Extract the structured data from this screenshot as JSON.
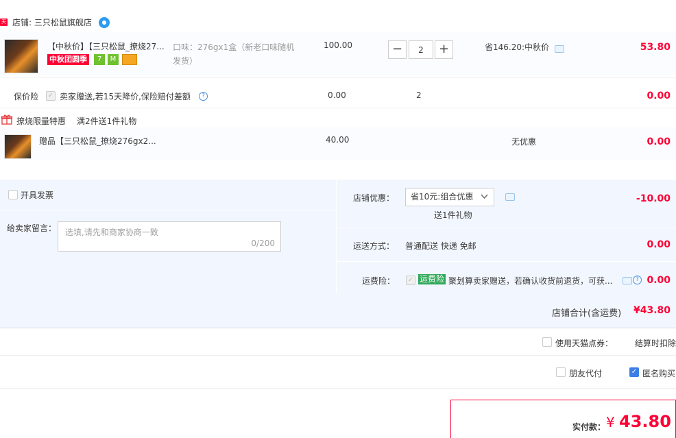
{
  "shop": {
    "badge": "天猫",
    "name": "店铺: 三只松鼠旗舰店"
  },
  "product": {
    "title": "【中秋价】【三只松鼠_撩烧27...",
    "tag_promo": "中秋团圆季",
    "tag_green_1": "7",
    "tag_green_2": "M",
    "sku_line1": "口味：276gx1盒（新老口味随机",
    "sku_line2": "发货）",
    "unit_price": "100.00",
    "quantity": "2",
    "qty_minus": "−",
    "qty_plus": "+",
    "discount": "省146.20:中秋价",
    "total": "53.80"
  },
  "insurance": {
    "label": "保价险",
    "desc": "卖家赠送,若15天降价,保险赔付差额",
    "help": "?",
    "unit_price": "0.00",
    "quantity": "2",
    "total": "0.00"
  },
  "gift_promo": {
    "title": "撩烧限量特惠",
    "rule": "满2件送1件礼物"
  },
  "gift": {
    "title": "赠品【三只松鼠_撩烧276gx2...",
    "unit_price": "40.00",
    "discount": "无优惠",
    "total": "0.00"
  },
  "invoice": {
    "label": "开具发票"
  },
  "memo": {
    "label": "给卖家留言：",
    "placeholder": "选填,请先和商家协商一致",
    "counter": "0/200"
  },
  "shop_discount": {
    "label": "店铺优惠：",
    "selected": "省10元:组合优惠",
    "sub": "送1件礼物",
    "amount": "-10.00"
  },
  "shipping": {
    "label": "运送方式：",
    "value": "普通配送 快递 免邮",
    "amount": "0.00"
  },
  "freight_insurance": {
    "label": "运费险：",
    "badge": "运费险",
    "desc": "聚划算卖家赠送，若确认收货前退货，可获...",
    "help": "?",
    "amount": "0.00"
  },
  "shop_total": {
    "label": "店铺合计(含运费)",
    "amount": "¥43.80"
  },
  "coupon": {
    "label": "使用天猫点券：",
    "note": "结算时扣除"
  },
  "friend_pay": {
    "label": "朋友代付"
  },
  "anonymous": {
    "label": "匿名购买"
  },
  "final": {
    "label": "实付款：",
    "currency": "¥",
    "amount": "43.80"
  },
  "colors": {
    "accent_red": "#ff0036",
    "panel_blue": "#f2f7ff",
    "checkbox_blue": "#3c7de6",
    "badge_green": "#2fa858"
  }
}
